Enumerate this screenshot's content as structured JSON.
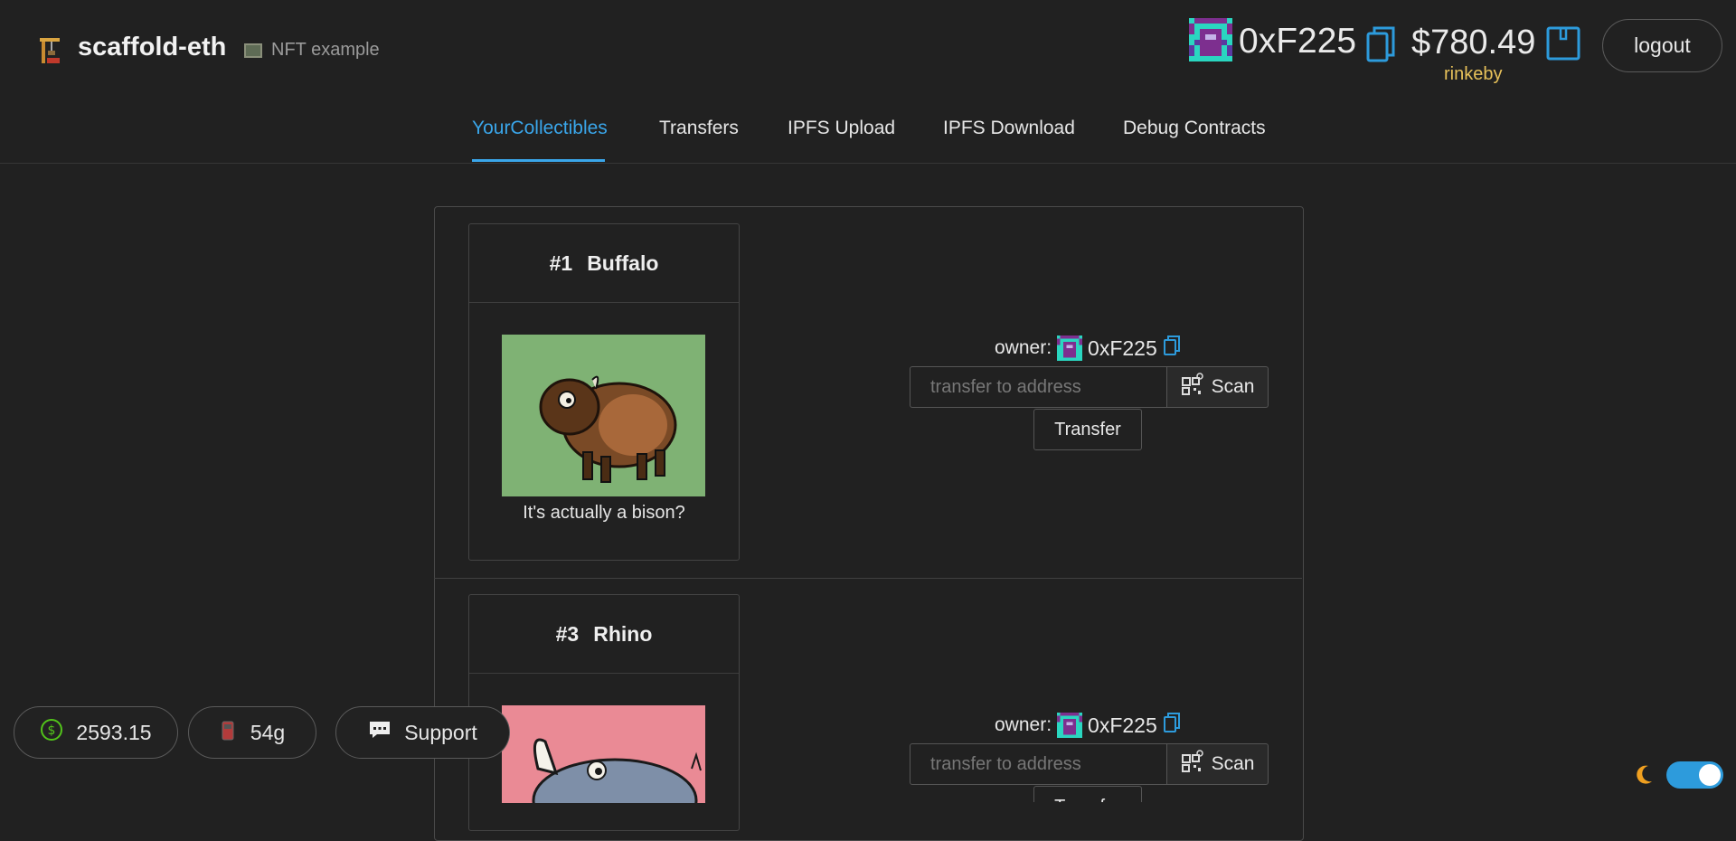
{
  "header": {
    "app_title": "scaffold-eth",
    "subtitle": "NFT example",
    "account": {
      "address": "0xF225",
      "balance": "$780.49",
      "network": "rinkeby"
    },
    "logout_label": "logout"
  },
  "nav": {
    "tabs": [
      {
        "label": "YourCollectibles",
        "active": true
      },
      {
        "label": "Transfers",
        "active": false
      },
      {
        "label": "IPFS Upload",
        "active": false
      },
      {
        "label": "IPFS Download",
        "active": false
      },
      {
        "label": "Debug Contracts",
        "active": false
      }
    ]
  },
  "collectibles": [
    {
      "id": "#1",
      "name": "Buffalo",
      "description": "It's actually a bison?",
      "owner_label": "owner:",
      "owner_address": "0xF225",
      "input_placeholder": "transfer to address",
      "scan_label": "Scan",
      "transfer_label": "Transfer",
      "image_bg": "#7fb274"
    },
    {
      "id": "#3",
      "name": "Rhino",
      "owner_label": "owner:",
      "owner_address": "0xF225",
      "input_placeholder": "transfer to address",
      "scan_label": "Scan",
      "transfer_label": "Transfer",
      "image_bg": "#ea8a95"
    }
  ],
  "footer": {
    "eth_price": "2593.15",
    "gas": "54g",
    "support_label": "Support"
  },
  "colors": {
    "accent": "#3aa6ea",
    "network": "#e7c15a",
    "background": "#212121"
  }
}
